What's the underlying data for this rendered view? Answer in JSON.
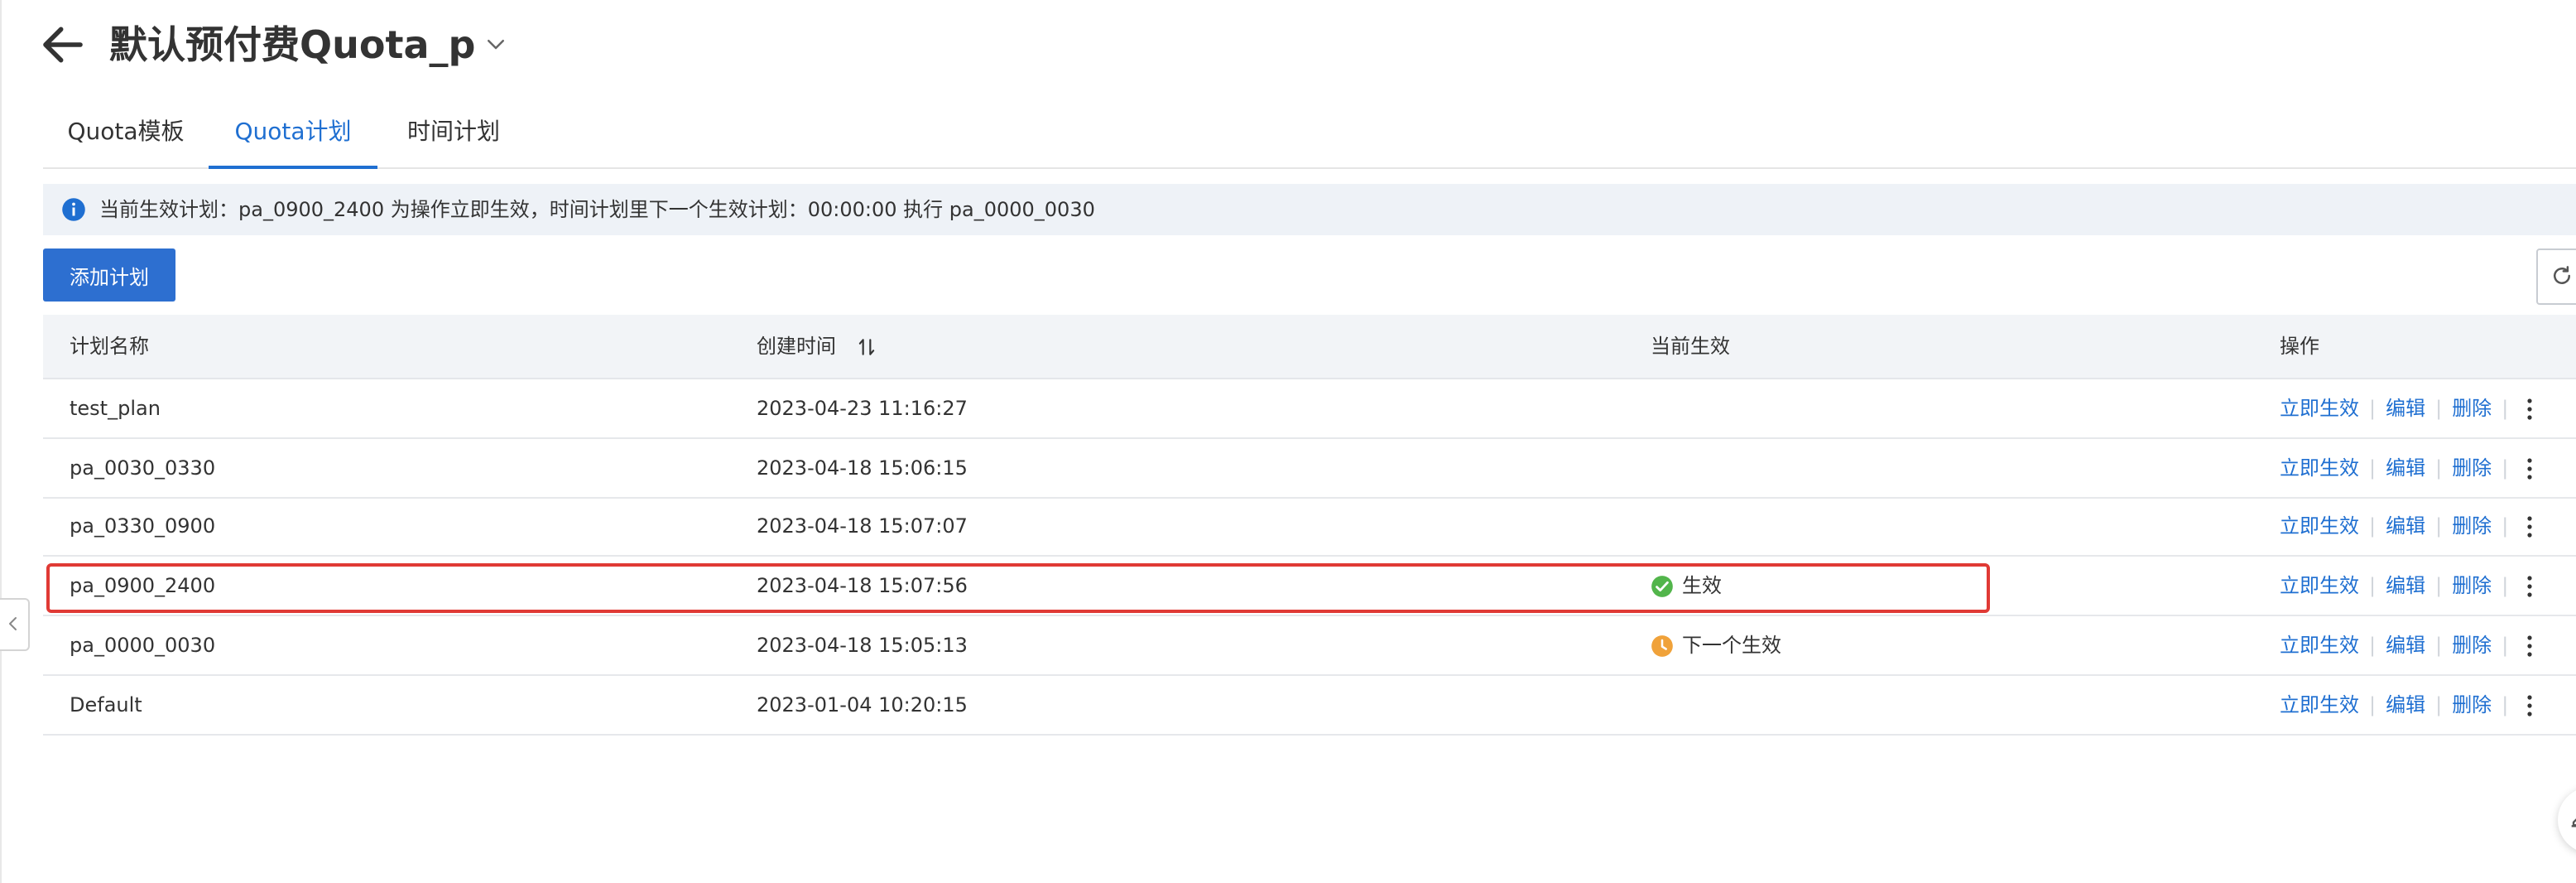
{
  "header": {
    "title": "默认预付费Quota_p"
  },
  "tabs": [
    {
      "label": "Quota模板",
      "active": false
    },
    {
      "label": "Quota计划",
      "active": true
    },
    {
      "label": "时间计划",
      "active": false
    }
  ],
  "alert": {
    "text": "当前生效计划：pa_0900_2400 为操作立即生效，时间计划里下一个生效计划：00:00:00 执行 pa_0000_0030"
  },
  "toolbar": {
    "add_label": "添加计划"
  },
  "table": {
    "columns": {
      "name": "计划名称",
      "created": "创建时间",
      "current": "当前生效",
      "ops": "操作"
    },
    "actions": {
      "apply": "立即生效",
      "edit": "编辑",
      "delete": "删除"
    },
    "rows": [
      {
        "name": "test_plan",
        "created": "2023-04-23 11:16:27",
        "status": ""
      },
      {
        "name": "pa_0030_0330",
        "created": "2023-04-18 15:06:15",
        "status": ""
      },
      {
        "name": "pa_0330_0900",
        "created": "2023-04-18 15:07:07",
        "status": ""
      },
      {
        "name": "pa_0900_2400",
        "created": "2023-04-18 15:07:56",
        "status": "生效",
        "status_icon": "check-circle-icon",
        "status_color": "#52b54b",
        "highlighted": true
      },
      {
        "name": "pa_0000_0030",
        "created": "2023-04-18 15:05:13",
        "status": "下一个生效",
        "status_icon": "clock-icon",
        "status_color": "#f0a23a"
      },
      {
        "name": "Default",
        "created": "2023-01-04 10:20:15",
        "status": ""
      }
    ]
  },
  "colors": {
    "primary": "#1f6fd1",
    "button": "#2d6fd0",
    "alert_bg": "#eef2f7",
    "highlight": "#e03a35"
  }
}
